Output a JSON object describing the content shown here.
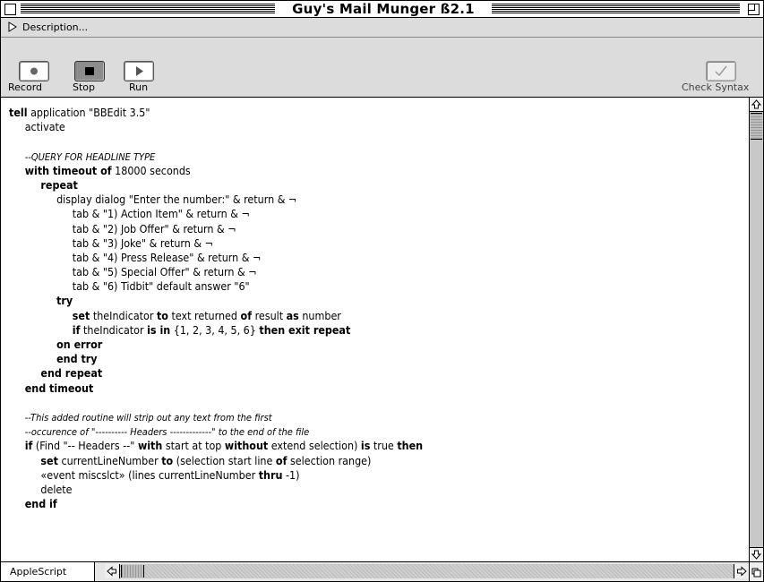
{
  "window": {
    "title": "Guy's Mail Munger ß2.1"
  },
  "description": {
    "label": "Description..."
  },
  "toolbar": {
    "record_label": "Record",
    "stop_label": "Stop",
    "run_label": "Run",
    "check_syntax_label": "Check Syntax"
  },
  "footer": {
    "language": "AppleScript"
  },
  "script": {
    "lines": [
      [
        {
          "t": "tell",
          "s": "b"
        },
        {
          "t": " application \"BBEdit 3.5\""
        }
      ],
      [
        {
          "t": "     activate"
        }
      ],
      [
        {
          "t": ""
        }
      ],
      [
        {
          "t": "     "
        },
        {
          "t": "--QUERY FOR HEADLINE TYPE",
          "s": "i"
        }
      ],
      [
        {
          "t": "     "
        },
        {
          "t": "with timeout of",
          "s": "b"
        },
        {
          "t": " 18000 seconds"
        }
      ],
      [
        {
          "t": "          "
        },
        {
          "t": "repeat",
          "s": "b"
        }
      ],
      [
        {
          "t": "               display dialog \"Enter the number:\" & return & ¬"
        }
      ],
      [
        {
          "t": "                    tab & \"1) Action Item\" & return & ¬"
        }
      ],
      [
        {
          "t": "                    tab & \"2) Job Offer\" & return & ¬"
        }
      ],
      [
        {
          "t": "                    tab & \"3) Joke\" & return & ¬"
        }
      ],
      [
        {
          "t": "                    tab & \"4) Press Release\" & return & ¬"
        }
      ],
      [
        {
          "t": "                    tab & \"5) Special Offer\" & return & ¬"
        }
      ],
      [
        {
          "t": "                    tab & \"6) Tidbit\" default answer \"6\""
        }
      ],
      [
        {
          "t": "               "
        },
        {
          "t": "try",
          "s": "b"
        }
      ],
      [
        {
          "t": "                    "
        },
        {
          "t": "set",
          "s": "b"
        },
        {
          "t": " theIndicator "
        },
        {
          "t": "to",
          "s": "b"
        },
        {
          "t": " text returned "
        },
        {
          "t": "of",
          "s": "b"
        },
        {
          "t": " result "
        },
        {
          "t": "as",
          "s": "b"
        },
        {
          "t": " number"
        }
      ],
      [
        {
          "t": "                    "
        },
        {
          "t": "if",
          "s": "b"
        },
        {
          "t": " theIndicator "
        },
        {
          "t": "is in",
          "s": "b"
        },
        {
          "t": " {1, 2, 3, 4, 5, 6} "
        },
        {
          "t": "then exit repeat",
          "s": "b"
        }
      ],
      [
        {
          "t": "               "
        },
        {
          "t": "on error",
          "s": "b"
        }
      ],
      [
        {
          "t": "               "
        },
        {
          "t": "end try",
          "s": "b"
        }
      ],
      [
        {
          "t": "          "
        },
        {
          "t": "end repeat",
          "s": "b"
        }
      ],
      [
        {
          "t": "     "
        },
        {
          "t": "end timeout",
          "s": "b"
        }
      ],
      [
        {
          "t": ""
        }
      ],
      [
        {
          "t": "     "
        },
        {
          "t": "--This added routine will strip out any text from the first",
          "s": "i"
        }
      ],
      [
        {
          "t": "     "
        },
        {
          "t": "--occurence of \"---------- Headers -------------\" to the end of the file",
          "s": "i"
        }
      ],
      [
        {
          "t": "     "
        },
        {
          "t": "if",
          "s": "b"
        },
        {
          "t": " (Find \"-- Headers --\" "
        },
        {
          "t": "with",
          "s": "b"
        },
        {
          "t": " start at top "
        },
        {
          "t": "without",
          "s": "b"
        },
        {
          "t": " extend selection) "
        },
        {
          "t": "is",
          "s": "b"
        },
        {
          "t": " true "
        },
        {
          "t": "then",
          "s": "b"
        }
      ],
      [
        {
          "t": "          "
        },
        {
          "t": "set",
          "s": "b"
        },
        {
          "t": " currentLineNumber "
        },
        {
          "t": "to",
          "s": "b"
        },
        {
          "t": " (selection start line "
        },
        {
          "t": "of",
          "s": "b"
        },
        {
          "t": " selection range)"
        }
      ],
      [
        {
          "t": "          «event miscslct» (lines currentLineNumber "
        },
        {
          "t": "thru",
          "s": "b"
        },
        {
          "t": " -1)"
        }
      ],
      [
        {
          "t": "          delete"
        }
      ],
      [
        {
          "t": "     "
        },
        {
          "t": "end if",
          "s": "b"
        }
      ]
    ]
  }
}
